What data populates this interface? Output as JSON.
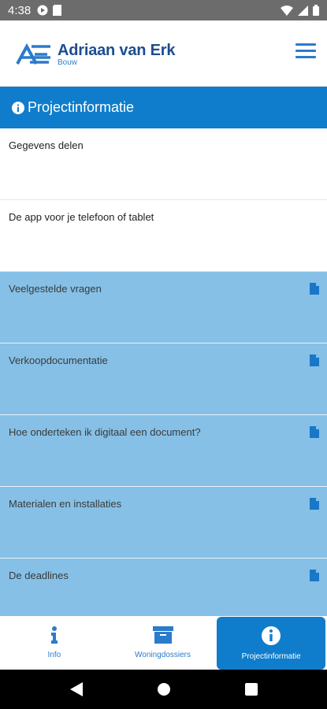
{
  "status_bar": {
    "time": "4:38",
    "left_icons": [
      "media-play-icon",
      "sim-icon"
    ],
    "right_icons": [
      "wifi-icon",
      "signal-icon",
      "battery-icon"
    ]
  },
  "header": {
    "brand": "Adriaan van Erk",
    "sub": "Bouw",
    "menu_icon": "hamburger-menu-icon"
  },
  "section": {
    "title": "Projectinformatie",
    "icon": "info-circle-icon"
  },
  "items": [
    {
      "label": "Gegevens delen",
      "has_doc": false
    },
    {
      "label": "De app voor je telefoon of tablet",
      "has_doc": false
    },
    {
      "label": "Veelgestelde vragen",
      "has_doc": true
    },
    {
      "label": "Verkoopdocumentatie",
      "has_doc": true
    },
    {
      "label": "Hoe onderteken ik digitaal een document?",
      "has_doc": true
    },
    {
      "label": "Materialen en installaties",
      "has_doc": true
    },
    {
      "label": "De deadlines",
      "has_doc": true
    }
  ],
  "tabs": [
    {
      "label": "Info",
      "icon": "info-icon",
      "active": false
    },
    {
      "label": "Woningdossiers",
      "icon": "archive-box-icon",
      "active": false
    },
    {
      "label": "Projectinformatie",
      "icon": "info-circle-icon",
      "active": true
    }
  ],
  "colors": {
    "primary": "#0f7dcb",
    "brand_dark": "#1e4d8f",
    "doc_row": "#86c0e6",
    "status_bar": "#6c6c6c"
  }
}
